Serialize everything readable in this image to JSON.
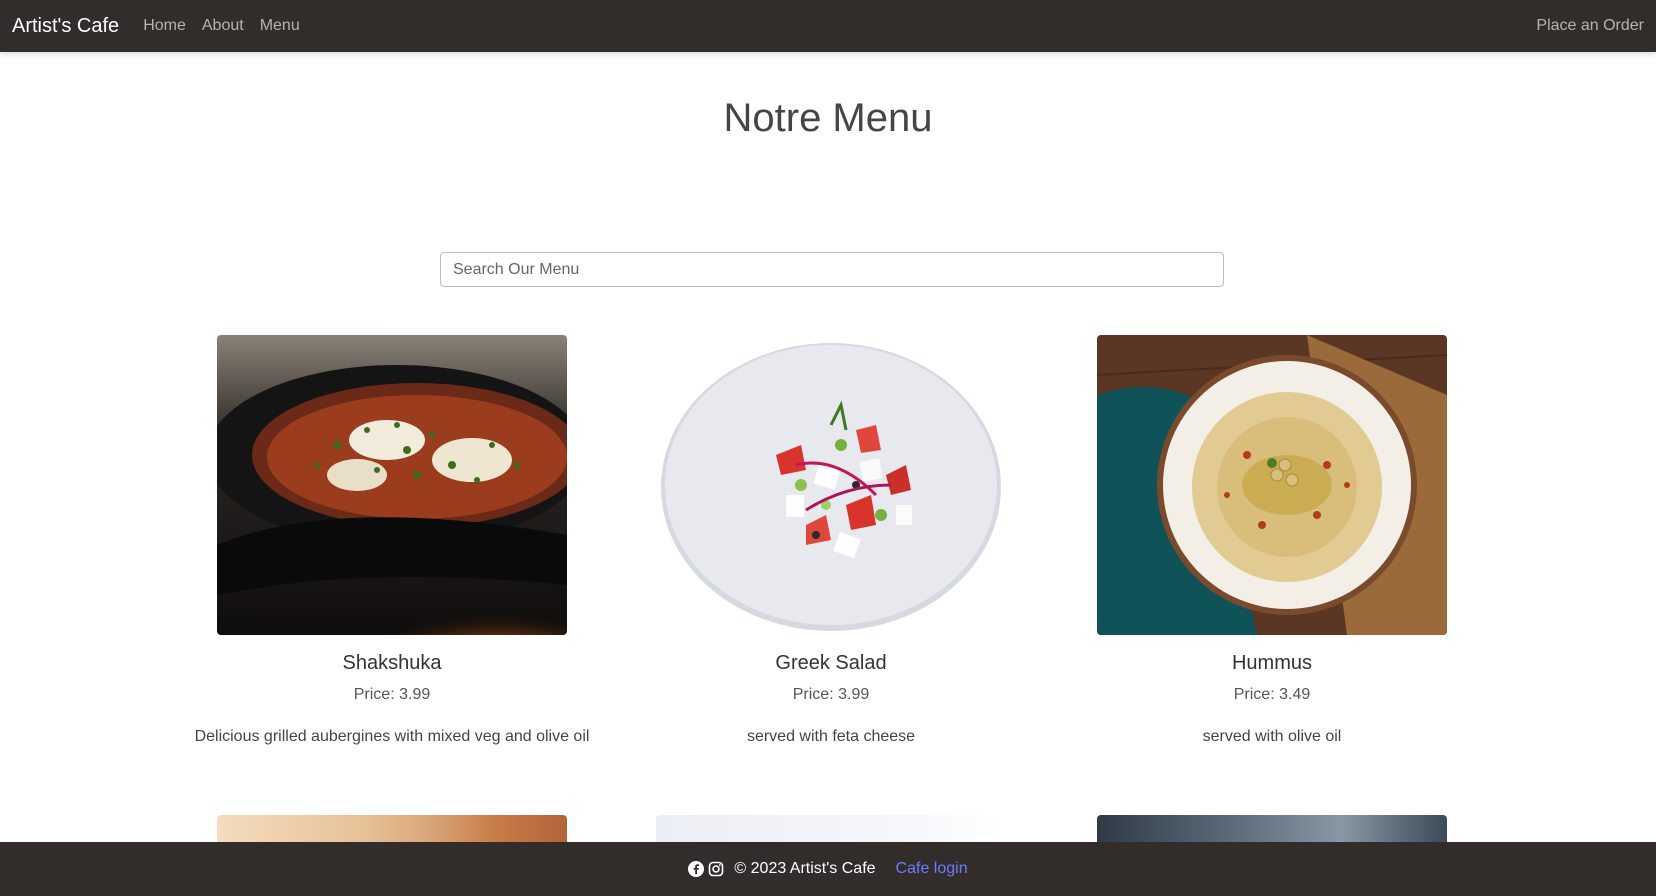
{
  "nav": {
    "brand": "Artist's Cafe",
    "links": [
      "Home",
      "About",
      "Menu"
    ],
    "order": "Place an Order"
  },
  "page": {
    "title": "Notre Menu",
    "search_placeholder": "Search Our Menu"
  },
  "menu_items": [
    {
      "name": "Shakshuka",
      "price": "Price: 3.99",
      "description": "Delicious grilled aubergines with mixed veg and olive oil"
    },
    {
      "name": "Greek Salad",
      "price": "Price: 3.99",
      "description": "served with feta cheese"
    },
    {
      "name": "Hummus",
      "price": "Price: 3.49",
      "description": "served with olive oil"
    }
  ],
  "footer": {
    "copyright": "© 2023 Artist's Cafe",
    "login": "Cafe login",
    "icons": [
      "facebook-icon",
      "instagram-icon"
    ]
  },
  "colors": {
    "navbar": "#322c2b",
    "link": "#6c7cff"
  }
}
